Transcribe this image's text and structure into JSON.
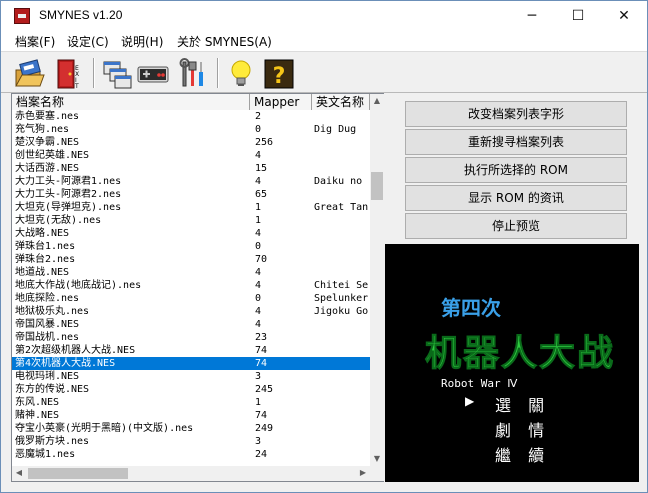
{
  "window": {
    "title": "SMYNES v1.20"
  },
  "titlebar": {
    "min": "─",
    "max": "☐",
    "close": "✕"
  },
  "menu": [
    "档案(F)",
    "设定(C)",
    "说明(H)",
    "关於 SMYNES(A)"
  ],
  "toolbar": {
    "icons": [
      "open-rom-icon",
      "exit-icon",
      "window-icon",
      "gamepad-icon",
      "tools-icon",
      "lightbulb-icon",
      "help-icon"
    ]
  },
  "list": {
    "headers": [
      "档案名称",
      "Mapper",
      "英文名称"
    ],
    "rows": [
      {
        "name": "赤色要塞.nes",
        "mapper": "2",
        "en": ""
      },
      {
        "name": "充气狗.nes",
        "mapper": "0",
        "en": "Dig Dug"
      },
      {
        "name": "楚汉争霸.NES",
        "mapper": "256",
        "en": ""
      },
      {
        "name": "创世纪英雄.NES",
        "mapper": "4",
        "en": ""
      },
      {
        "name": "大话西游.NES",
        "mapper": "15",
        "en": ""
      },
      {
        "name": "大力工头-阿源君1.nes",
        "mapper": "4",
        "en": "Daiku no"
      },
      {
        "name": "大力工头-阿源君2.nes",
        "mapper": "65",
        "en": ""
      },
      {
        "name": "大坦克(导弹坦克).nes",
        "mapper": "1",
        "en": "Great Tan"
      },
      {
        "name": "大坦克(无敌).nes",
        "mapper": "1",
        "en": ""
      },
      {
        "name": "大战略.NES",
        "mapper": "4",
        "en": ""
      },
      {
        "name": "弹珠台1.nes",
        "mapper": "0",
        "en": ""
      },
      {
        "name": "弹珠台2.nes",
        "mapper": "70",
        "en": ""
      },
      {
        "name": "地道战.NES",
        "mapper": "4",
        "en": ""
      },
      {
        "name": "地底大作战(地底战记).nes",
        "mapper": "4",
        "en": "Chitei Se"
      },
      {
        "name": "地底探险.nes",
        "mapper": "0",
        "en": "Spelunker"
      },
      {
        "name": "地狱极乐丸.nes",
        "mapper": "4",
        "en": "Jigoku Go"
      },
      {
        "name": "帝国风暴.NES",
        "mapper": "4",
        "en": ""
      },
      {
        "name": "帝国战机.nes",
        "mapper": "23",
        "en": ""
      },
      {
        "name": "第2次超级机器人大战.NES",
        "mapper": "74",
        "en": ""
      },
      {
        "name": "第4次机器人大战.NES",
        "mapper": "74",
        "en": ""
      },
      {
        "name": "电视玛琍.NES",
        "mapper": "3",
        "en": ""
      },
      {
        "name": "东方的传说.NES",
        "mapper": "245",
        "en": ""
      },
      {
        "name": "东风.NES",
        "mapper": "1",
        "en": ""
      },
      {
        "name": "赌神.NES",
        "mapper": "74",
        "en": ""
      },
      {
        "name": "夺宝小英豪(光明于黑暗)(中文版).nes",
        "mapper": "249",
        "en": ""
      },
      {
        "name": "俄罗斯方块.nes",
        "mapper": "3",
        "en": ""
      },
      {
        "name": "恶魔城1.nes",
        "mapper": "24",
        "en": ""
      }
    ],
    "selected_index": 19
  },
  "buttons": {
    "change_font": "改变档案列表字形",
    "rescan": "重新搜寻档案列表",
    "run": "执行所选择的 ROM",
    "info": "显示 ROM 的资讯",
    "stop_preview": "停止预览"
  },
  "preview": {
    "title1": "第四次",
    "title2": "机器人大战",
    "subtitle": "Robot War Ⅳ",
    "menu": [
      "選 關",
      "劇 情",
      "繼 續"
    ],
    "cursor": "▶"
  }
}
